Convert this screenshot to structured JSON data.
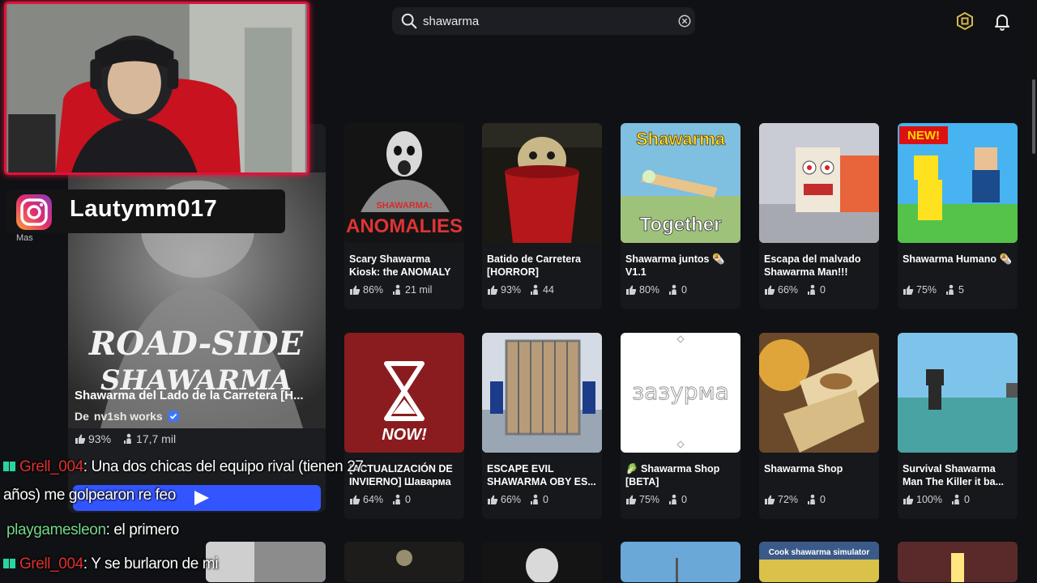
{
  "search": {
    "query": "shawarma"
  },
  "rail": {
    "label_1": "Mas"
  },
  "featured": {
    "title": "Shawarma del Lado de la Carretera [H...",
    "creator_prefix": "De",
    "creator": "nv1sh works",
    "rating": "93%",
    "players": "17,7 mil",
    "thumb_text_1": "ROAD-SIDE",
    "thumb_text_2": "SHAWARMA"
  },
  "games": [
    {
      "name": "Scary Shawarma Kiosk: the ANOMALY",
      "rating": "86%",
      "players": "21 mil",
      "thumb_text": "SHAWARMA: ANOMALIES"
    },
    {
      "name": "Batido de Carretera [HORROR]",
      "rating": "93%",
      "players": "44"
    },
    {
      "name": "Shawarma juntos 🌯 V1.1",
      "rating": "80%",
      "players": "0",
      "thumb_text_1": "Shawarma",
      "thumb_text_2": "Together"
    },
    {
      "name": "Escapa del malvado Shawarma Man!!!",
      "rating": "66%",
      "players": "0"
    },
    {
      "name": "Shawarma Humano 🌯",
      "rating": "75%",
      "players": "5",
      "thumb_text": "NEW!"
    },
    {
      "name": "[ACTUALIZACIÓN DE INVIERNO] Шаварма ...",
      "rating": "64%",
      "players": "0",
      "thumb_text": "NOW!"
    },
    {
      "name": "ESCAPE EVIL SHAWARMA OBY ES...",
      "rating": "66%",
      "players": "0"
    },
    {
      "name": "🥬 Shawarma Shop [BETA]",
      "rating": "75%",
      "players": "0",
      "thumb_text": "зазурма"
    },
    {
      "name": "Shawarma Shop",
      "rating": "72%",
      "players": "0"
    },
    {
      "name": "Survival  Shawarma Man The Killer it ba...",
      "rating": "100%",
      "players": "0"
    }
  ],
  "bottom_thumb_text": "Cook shawarma simulator",
  "overlay": {
    "instagram": "Lautymm017",
    "chat": [
      {
        "user": "Grell_004",
        "text": ": Una dos chicas del equipo rival (tienen 27"
      },
      {
        "user": "",
        "text": "años) me golpearon re feo"
      },
      {
        "user": "playgamesleon",
        "text": ": el primero"
      },
      {
        "user": "Grell_004",
        "text": ": Y se burlaron de mi"
      }
    ]
  },
  "colors": {
    "background": "#101114",
    "accent": "#3355ff",
    "webcam_border": "#e0123a"
  }
}
